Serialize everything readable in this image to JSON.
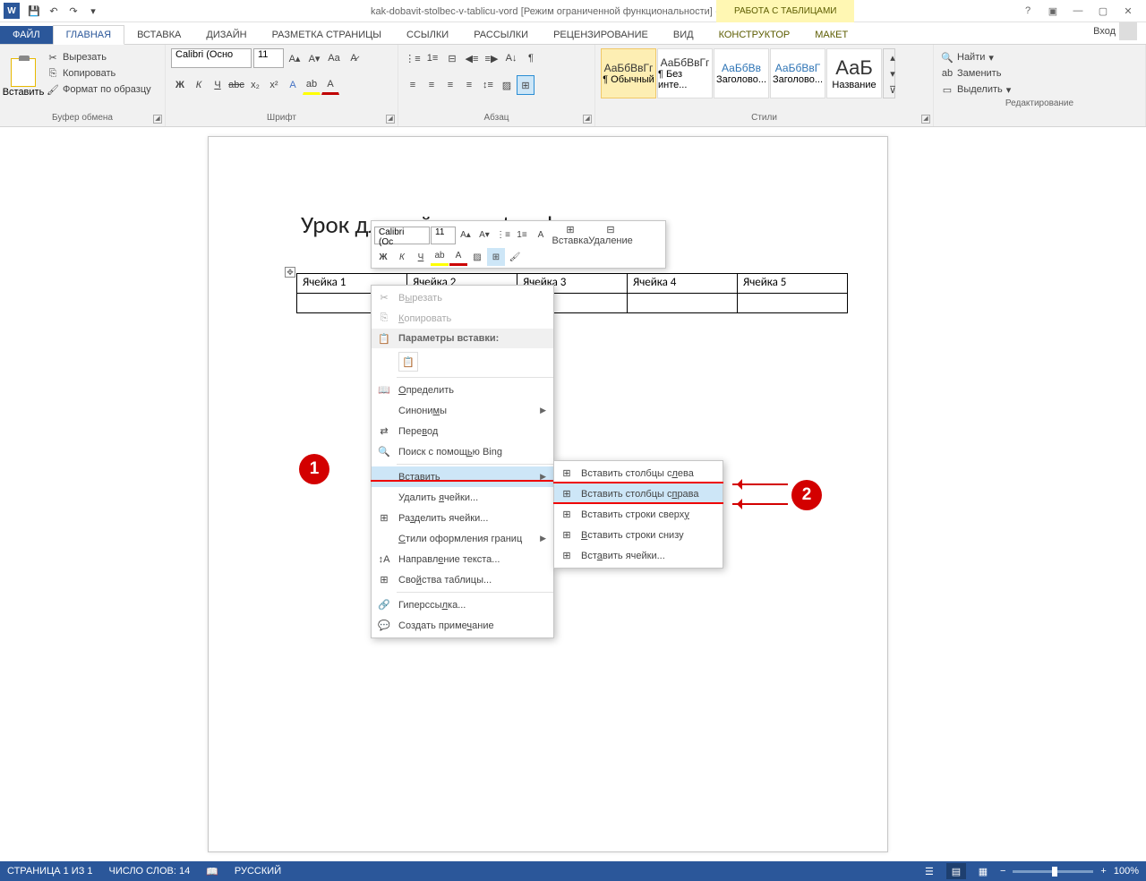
{
  "title": {
    "doc": "kak-dobavit-stolbec-v-tablicu-vord",
    "mode": "[Режим ограниченной функциональности]",
    "app": "- Word",
    "table_tools": "РАБОТА С ТАБЛИЦАМИ",
    "login": "Вход"
  },
  "tabs": {
    "file": "ФАЙЛ",
    "home": "ГЛАВНАЯ",
    "insert": "ВСТАВКА",
    "design": "ДИЗАЙН",
    "layout": "РАЗМЕТКА СТРАНИЦЫ",
    "references": "ССЫЛКИ",
    "mailings": "РАССЫЛКИ",
    "review": "РЕЦЕНЗИРОВАНИЕ",
    "view": "ВИД",
    "constructor": "КОНСТРУКТОР",
    "maket": "МАКЕТ"
  },
  "ribbon": {
    "clipboard": {
      "label": "Буфер обмена",
      "paste": "Вставить",
      "cut": "Вырезать",
      "copy": "Копировать",
      "format_painter": "Формат по образцу"
    },
    "font": {
      "label": "Шрифт",
      "name": "Calibri (Осно",
      "size": "11"
    },
    "paragraph": {
      "label": "Абзац"
    },
    "styles": {
      "label": "Стили",
      "items": [
        "¶ Обычный",
        "¶ Без инте...",
        "Заголово...",
        "Заголово...",
        "Название"
      ],
      "preview": "АаБбВвГг"
    },
    "editing": {
      "label": "Редактирование",
      "find": "Найти",
      "replace": "Заменить",
      "select": "Выделить"
    }
  },
  "document": {
    "heading": "Урок для сайта paratapok.ru",
    "cells": [
      "Ячейка 1",
      "Ячейка 2",
      "Ячейка 3",
      "Ячейка 4",
      "Ячейка 5"
    ]
  },
  "mini_toolbar": {
    "font": "Calibri (Ос",
    "size": "11",
    "insert": "Вставка",
    "delete": "Удаление"
  },
  "context_menu": {
    "cut": "Вырезать",
    "copy": "Копировать",
    "paste_options": "Параметры вставки:",
    "define": "Определить",
    "synonyms": "Синонимы",
    "translate": "Перевод",
    "bing": "Поиск с помощью Bing",
    "insert": "Вставить",
    "delete_cells": "Удалить ячейки...",
    "split_cells": "Разделить ячейки...",
    "border_styles": "Стили оформления границ",
    "text_direction": "Направление текста...",
    "table_props": "Свойства таблицы...",
    "hyperlink": "Гиперссылка...",
    "new_comment": "Создать примечание"
  },
  "submenu": {
    "cols_left": "Вставить столбцы слева",
    "cols_right": "Вставить столбцы справа",
    "rows_above": "Вставить строки сверху",
    "rows_below": "Вставить строки снизу",
    "cells": "Вставить ячейки..."
  },
  "annotations": {
    "one": "1",
    "two": "2"
  },
  "statusbar": {
    "page": "СТРАНИЦА 1 ИЗ 1",
    "words": "ЧИСЛО СЛОВ: 14",
    "lang": "РУССКИЙ",
    "zoom": "100%"
  }
}
